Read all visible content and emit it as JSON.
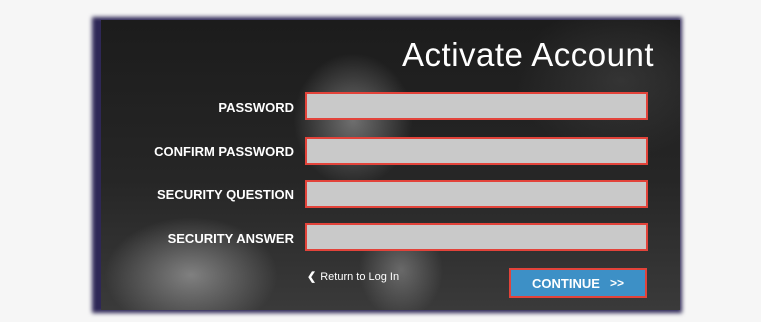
{
  "form": {
    "title": "Activate Account",
    "fields": [
      {
        "label": "PASSWORD",
        "value": ""
      },
      {
        "label": "CONFIRM PASSWORD",
        "value": ""
      },
      {
        "label": "SECURITY QUESTION",
        "value": ""
      },
      {
        "label": "SECURITY ANSWER",
        "value": ""
      }
    ],
    "return_link": "Return to Log In",
    "continue_label": "CONTINUE",
    "continue_arrows": ">>"
  },
  "colors": {
    "field_border": "#e2433a",
    "field_background": "#c9c9c9",
    "button_background": "#3d90c6",
    "panel_background": "#1c1c1c"
  }
}
